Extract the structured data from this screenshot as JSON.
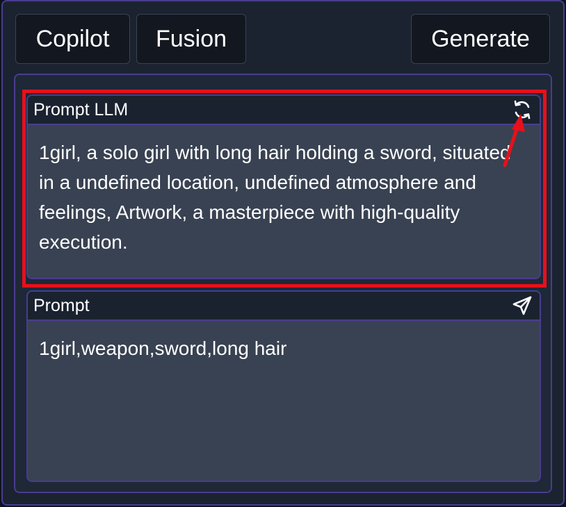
{
  "toolbar": {
    "copilot_label": "Copilot",
    "fusion_label": "Fusion",
    "generate_label": "Generate"
  },
  "prompt_llm": {
    "label": "Prompt LLM",
    "icon": "refresh-icon",
    "text": "1girl, a solo girl with long hair holding a sword, situated in a undefined location, undefined atmosphere and feelings, Artwork, a masterpiece with high-quality execution."
  },
  "prompt": {
    "label": "Prompt",
    "icon": "send-icon",
    "text": "1girl,weapon,sword,long hair"
  },
  "colors": {
    "accent_border": "#4a3c8f",
    "annotation_red": "#e8101a",
    "field_bg": "#394252"
  }
}
